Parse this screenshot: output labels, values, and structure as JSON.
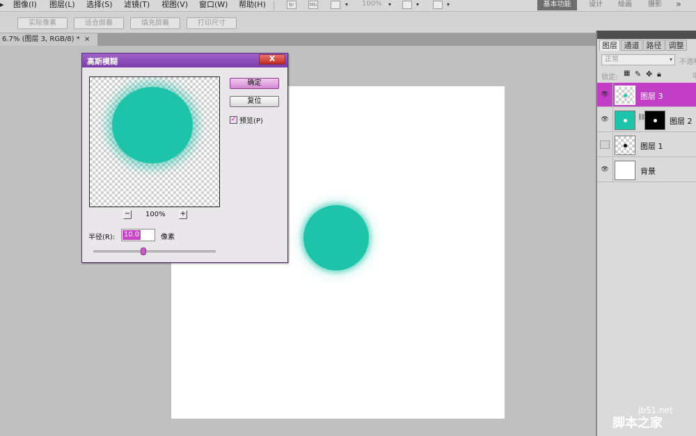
{
  "menubar": {
    "items": [
      "图像(I)",
      "图层(L)",
      "选择(S)",
      "滤镜(T)",
      "视图(V)",
      "窗口(W)",
      "帮助(H)"
    ],
    "zoom": "100%",
    "workspaces": [
      "基本功能",
      "设计",
      "绘画",
      "摄影"
    ],
    "more_glyph": "»"
  },
  "options_bar": {
    "buttons": [
      "实际像素",
      "适合屏幕",
      "填充屏幕",
      "打印尺寸"
    ]
  },
  "document": {
    "tab_title": "6.7% (图层 3, RGB/8) *",
    "close_glyph": "×"
  },
  "layers_panel": {
    "tabs": [
      "图层",
      "通道",
      "路径",
      "调整"
    ],
    "blend_mode": "正常",
    "opacity_label": "不透明",
    "lock_label": "锁定:",
    "fill_label": "填",
    "layers": [
      {
        "name": "图层 3",
        "visible": true,
        "selected": true
      },
      {
        "name": "图层 2",
        "visible": true,
        "selected": false
      },
      {
        "name": "图层 1",
        "visible": false,
        "selected": false
      },
      {
        "name": "背景",
        "visible": true,
        "selected": false
      }
    ],
    "colors": {
      "selected_row": "#c33ec7",
      "swatch": "#1ec4aa"
    }
  },
  "dialog": {
    "title": "高斯模糊",
    "close_glyph": "X",
    "ok_label": "确定",
    "reset_label": "复位",
    "preview_label": "预览(P)",
    "preview_checked": true,
    "zoom_out": "−",
    "zoom_in": "+",
    "zoom_level": "100%",
    "radius_label": "半径(R):",
    "radius_value": "10.0",
    "radius_unit": "像素",
    "accent": "#c944c9"
  },
  "watermark": {
    "url": "jb51.net",
    "mark": "脚本之家"
  }
}
